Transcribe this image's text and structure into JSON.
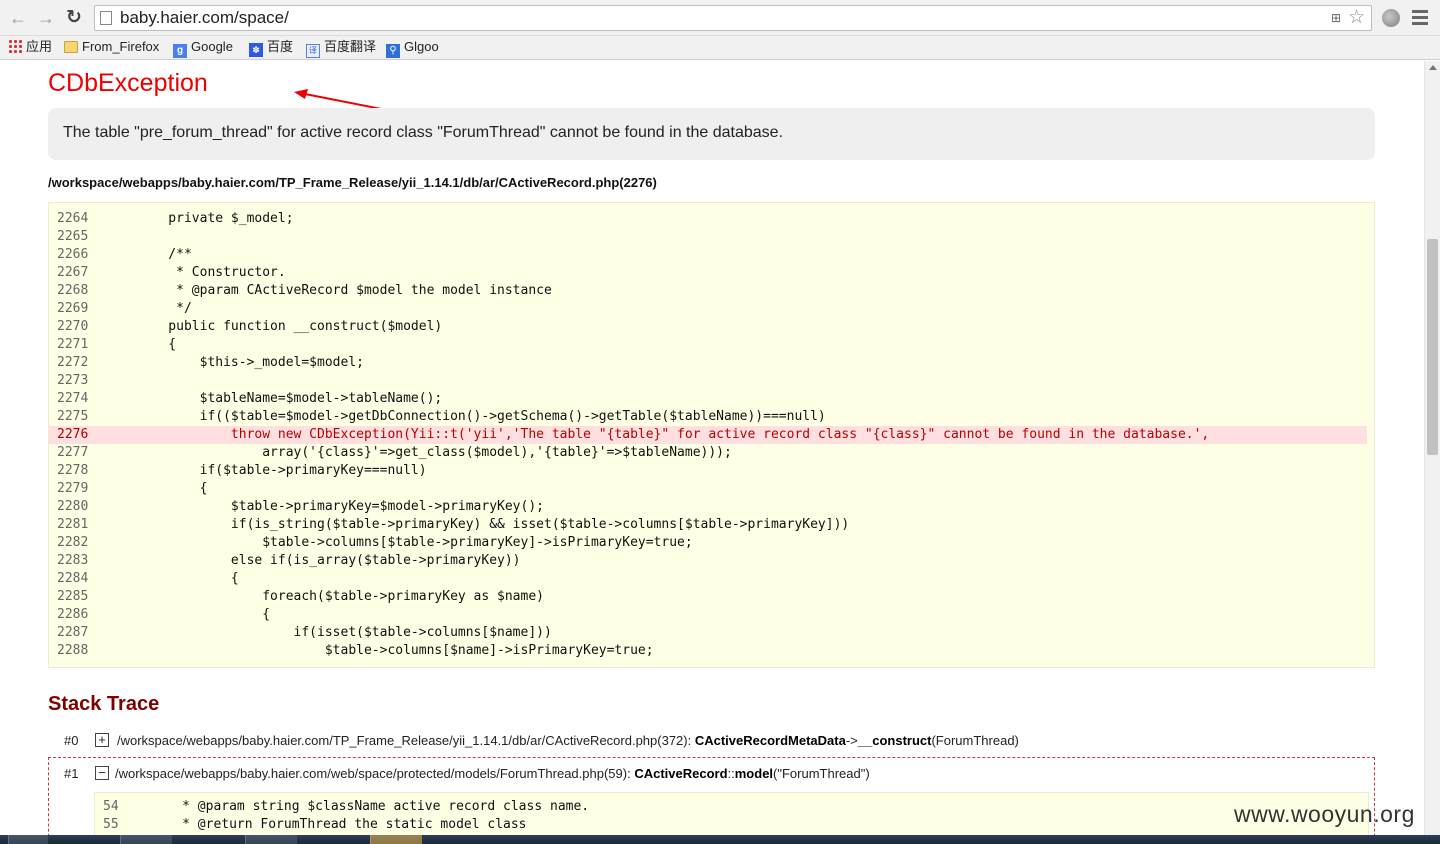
{
  "browser": {
    "url": "baby.haier.com/space/",
    "bookmarks": [
      "应用",
      "From_Firefox",
      "Google",
      "百度",
      "百度翻译",
      "Glgoo"
    ]
  },
  "error": {
    "title": "CDbException",
    "message": "The table \"pre_forum_thread\" for active record class \"ForumThread\" cannot be found in the database.",
    "file": "/workspace/webapps/baby.haier.com/TP_Frame_Release/yii_1.14.1/db/ar/CActiveRecord.php(2276)"
  },
  "code": {
    "highlight_line": "2276",
    "lines": [
      {
        "n": "2264",
        "t": "    private $_model;"
      },
      {
        "n": "2265",
        "t": ""
      },
      {
        "n": "2266",
        "t": "    /**"
      },
      {
        "n": "2267",
        "t": "     * Constructor."
      },
      {
        "n": "2268",
        "t": "     * @param CActiveRecord $model the model instance"
      },
      {
        "n": "2269",
        "t": "     */"
      },
      {
        "n": "2270",
        "t": "    public function __construct($model)"
      },
      {
        "n": "2271",
        "t": "    {"
      },
      {
        "n": "2272",
        "t": "        $this->_model=$model;"
      },
      {
        "n": "2273",
        "t": ""
      },
      {
        "n": "2274",
        "t": "        $tableName=$model->tableName();"
      },
      {
        "n": "2275",
        "t": "        if(($table=$model->getDbConnection()->getSchema()->getTable($tableName))===null)"
      },
      {
        "n": "2276",
        "t": "            throw new CDbException(Yii::t('yii','The table \"{table}\" for active record class \"{class}\" cannot be found in the database.',"
      },
      {
        "n": "2277",
        "t": "                array('{class}'=>get_class($model),'{table}'=>$tableName)));"
      },
      {
        "n": "2278",
        "t": "        if($table->primaryKey===null)"
      },
      {
        "n": "2279",
        "t": "        {"
      },
      {
        "n": "2280",
        "t": "            $table->primaryKey=$model->primaryKey();"
      },
      {
        "n": "2281",
        "t": "            if(is_string($table->primaryKey) && isset($table->columns[$table->primaryKey]))"
      },
      {
        "n": "2282",
        "t": "                $table->columns[$table->primaryKey]->isPrimaryKey=true;"
      },
      {
        "n": "2283",
        "t": "            else if(is_array($table->primaryKey))"
      },
      {
        "n": "2284",
        "t": "            {"
      },
      {
        "n": "2285",
        "t": "                foreach($table->primaryKey as $name)"
      },
      {
        "n": "2286",
        "t": "                {"
      },
      {
        "n": "2287",
        "t": "                    if(isset($table->columns[$name]))"
      },
      {
        "n": "2288",
        "t": "                        $table->columns[$name]->isPrimaryKey=true;"
      }
    ]
  },
  "stack": {
    "title": "Stack Trace",
    "items": [
      {
        "index": "#0",
        "toggle": "+",
        "path": "/workspace/webapps/baby.haier.com/TP_Frame_Release/yii_1.14.1/db/ar/CActiveRecord.php(372): ",
        "cls": "CActiveRecordMetaData",
        "sep": "->",
        "method": "__construct",
        "args": "(ForumThread)"
      },
      {
        "index": "#1",
        "toggle": "−",
        "path": "/workspace/webapps/baby.haier.com/web/space/protected/models/ForumThread.php(59): ",
        "cls": "CActiveRecord",
        "sep": "::",
        "method": "model",
        "args": "(\"ForumThread\")",
        "code": [
          {
            "n": "54",
            "t": "     * @param string $className active record class name."
          },
          {
            "n": "55",
            "t": "     * @return ForumThread the static model class"
          }
        ]
      }
    ]
  },
  "watermark": "www.wooyun.org"
}
